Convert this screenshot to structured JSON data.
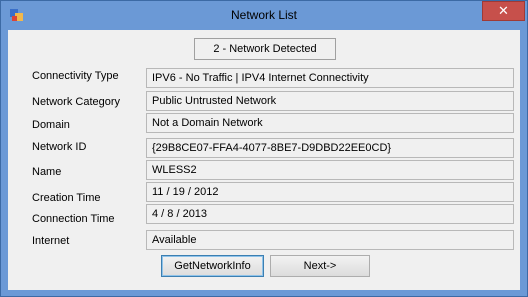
{
  "window": {
    "title": "Network List",
    "close_label": "✕"
  },
  "status": "2 - Network Detected",
  "fields": [
    {
      "label": "Connectivity Type",
      "value": "IPV6 - No Traffic | IPV4 Internet Connectivity"
    },
    {
      "label": "Network Category",
      "value": "Public Untrusted Network"
    },
    {
      "label": "Domain",
      "value": "Not a Domain Network"
    },
    {
      "label": "Network ID",
      "value": "{29B8CE07-FFA4-4077-8BE7-D9DBD22EE0CD}"
    },
    {
      "label": "Name",
      "value": "WLESS2"
    },
    {
      "label": "Creation Time",
      "value": "11 / 19 / 2012"
    },
    {
      "label": "Connection Time",
      "value": "4 / 8 / 2013"
    },
    {
      "label": "Internet",
      "value": "Available"
    }
  ],
  "buttons": {
    "get_info": "GetNetworkInfo",
    "next": "Next->"
  },
  "icons": {
    "app": "app-icon",
    "close": "close-icon"
  },
  "colors": {
    "frame": "#6b99d6",
    "close": "#c7504b",
    "client": "#f0f0f0"
  }
}
